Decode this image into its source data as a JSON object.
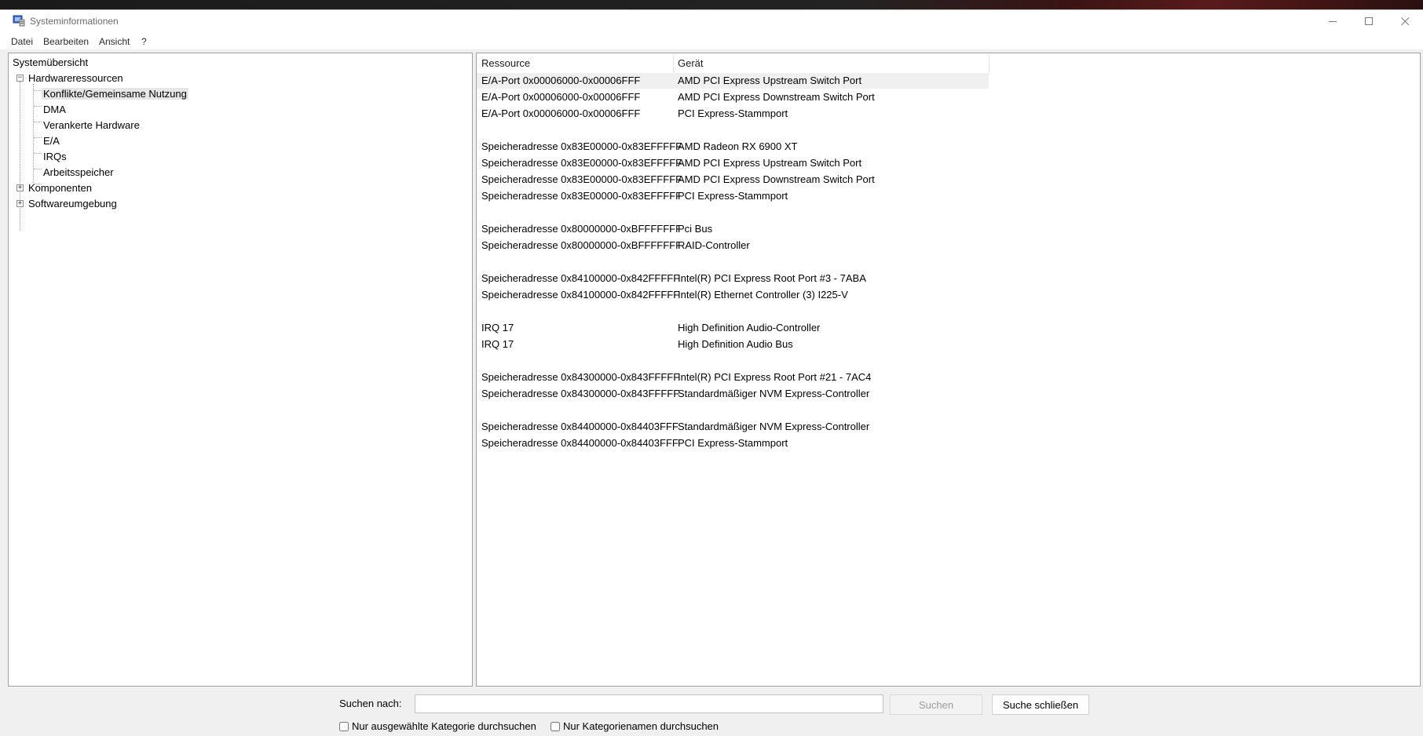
{
  "window": {
    "title": "Systeminformationen",
    "controls": [
      "minimize-icon",
      "maximize-icon",
      "close-icon"
    ]
  },
  "menu": [
    "Datei",
    "Bearbeiten",
    "Ansicht",
    "?"
  ],
  "tree": {
    "root": "Systemübersicht",
    "hardware": "Hardwareressourcen",
    "hardware_children": [
      "Konflikte/Gemeinsame Nutzung",
      "DMA",
      "Verankerte Hardware",
      "E/A",
      "IRQs",
      "Arbeitsspeicher"
    ],
    "selected": "Konflikte/Gemeinsame Nutzung",
    "components": "Komponenten",
    "software": "Softwareumgebung"
  },
  "table": {
    "headers": {
      "resource": "Ressource",
      "device": "Gerät"
    },
    "rows": [
      {
        "resource": "E/A-Port 0x00006000-0x00006FFF",
        "device": "AMD PCI Express Upstream Switch Port"
      },
      {
        "resource": "E/A-Port 0x00006000-0x00006FFF",
        "device": "AMD PCI Express Downstream Switch Port"
      },
      {
        "resource": "E/A-Port 0x00006000-0x00006FFF",
        "device": "PCI Express-Stammport"
      },
      {
        "resource": "",
        "device": ""
      },
      {
        "resource": "Speicheradresse 0x83E00000-0x83EFFFFF",
        "device": "AMD Radeon RX 6900 XT"
      },
      {
        "resource": "Speicheradresse 0x83E00000-0x83EFFFFF",
        "device": "AMD PCI Express Upstream Switch Port"
      },
      {
        "resource": "Speicheradresse 0x83E00000-0x83EFFFFF",
        "device": "AMD PCI Express Downstream Switch Port"
      },
      {
        "resource": "Speicheradresse 0x83E00000-0x83EFFFFF",
        "device": "PCI Express-Stammport"
      },
      {
        "resource": "",
        "device": ""
      },
      {
        "resource": "Speicheradresse 0x80000000-0xBFFFFFFF",
        "device": "Pci Bus"
      },
      {
        "resource": "Speicheradresse 0x80000000-0xBFFFFFFF",
        "device": "RAID-Controller"
      },
      {
        "resource": "",
        "device": ""
      },
      {
        "resource": "Speicheradresse 0x84100000-0x842FFFFF",
        "device": "Intel(R) PCI Express Root Port #3 - 7ABA"
      },
      {
        "resource": "Speicheradresse 0x84100000-0x842FFFFF",
        "device": "Intel(R) Ethernet Controller (3) I225-V"
      },
      {
        "resource": "",
        "device": ""
      },
      {
        "resource": "IRQ 17",
        "device": "High Definition Audio-Controller"
      },
      {
        "resource": "IRQ 17",
        "device": "High Definition Audio Bus"
      },
      {
        "resource": "",
        "device": ""
      },
      {
        "resource": "Speicheradresse 0x84300000-0x843FFFFF",
        "device": "Intel(R) PCI Express Root Port #21 - 7AC4"
      },
      {
        "resource": "Speicheradresse 0x84300000-0x843FFFFF",
        "device": "Standardmäßiger NVM Express-Controller"
      },
      {
        "resource": "",
        "device": ""
      },
      {
        "resource": "Speicheradresse 0x84400000-0x84403FFF",
        "device": "Standardmäßiger NVM Express-Controller"
      },
      {
        "resource": "Speicheradresse 0x84400000-0x84403FFF",
        "device": "PCI Express-Stammport"
      }
    ]
  },
  "search": {
    "label": "Suchen nach:",
    "value": "",
    "search_button": "Suchen",
    "close_button": "Suche schließen",
    "option_selected_category": "Nur ausgewählte Kategorie durchsuchen",
    "option_category_names": "Nur Kategorienamen durchsuchen"
  },
  "colors": {
    "selection": "#e6e6e6",
    "row_highlight": "#f0f0f0",
    "window_bg": "#f0f0f0"
  }
}
